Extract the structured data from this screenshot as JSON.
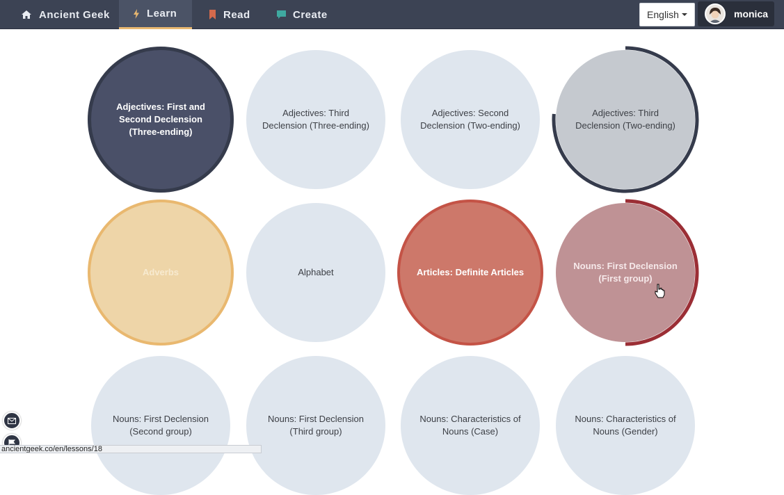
{
  "nav": {
    "brand": "Ancient Geek",
    "learn": "Learn",
    "read": "Read",
    "create": "Create",
    "language": "English",
    "user": "monica"
  },
  "colors": {
    "nav_bg": "#3c4354",
    "active_underline": "#e8b770",
    "read_icon": "#d56a4c",
    "create_icon": "#3fa9a0",
    "progress_ring": "#353b4c",
    "progress_ring_red": "#9b2e35"
  },
  "lessons": [
    {
      "title": "Adjectives: First and Second Declension (Three-ending)",
      "state": "completed"
    },
    {
      "title": "Adjectives: Third Declension (Three-ending)",
      "state": "not-started"
    },
    {
      "title": "Adjectives: Second Declension (Two-ending)",
      "state": "not-started"
    },
    {
      "title": "Adjectives: Third Declension (Two-ending)",
      "state": "in-progress",
      "progress": 0.7
    },
    {
      "title": "Adverbs",
      "state": "completed"
    },
    {
      "title": "Alphabet",
      "state": "not-started"
    },
    {
      "title": "Articles: Definite Articles",
      "state": "completed"
    },
    {
      "title": "Nouns: First Declension (First group)",
      "state": "in-progress",
      "progress": 0.5
    },
    {
      "title": "Nouns: First Declension (Second group)",
      "state": "not-started"
    },
    {
      "title": "Nouns: First Declension (Third group)",
      "state": "not-started"
    },
    {
      "title": "Nouns: Characteristics of Nouns (Case)",
      "state": "not-started"
    },
    {
      "title": "Nouns: Characteristics of Nouns (Gender)",
      "state": "not-started"
    }
  ],
  "status_bar": "ancientgeek.co/en/lessons/18"
}
